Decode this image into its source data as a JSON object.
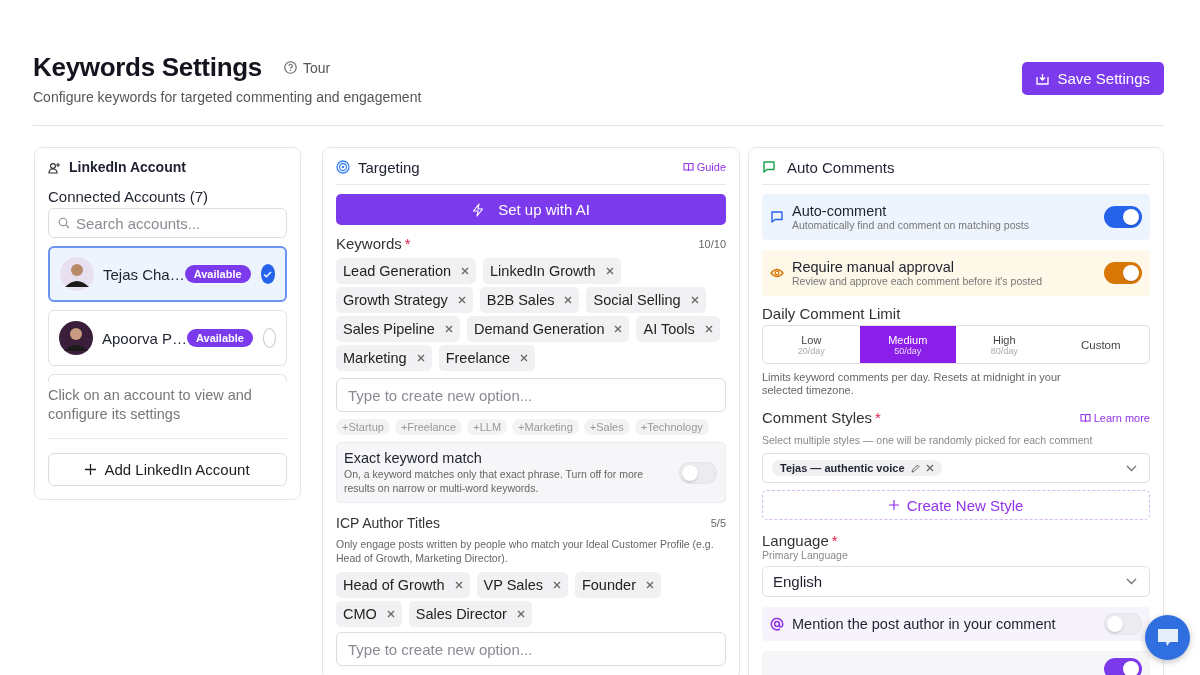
{
  "header": {
    "title": "Keywords Settings",
    "tour": "Tour",
    "subtitle": "Configure keywords for targeted commenting and engagement",
    "save_button": "Save Settings"
  },
  "accounts_panel": {
    "title": "LinkedIn Account",
    "connected_label": "Connected Accounts (7)",
    "search": {
      "placeholder": "Search accounts..."
    },
    "accounts": [
      {
        "name": "Tejas Cha…",
        "badge": "Available",
        "selected": true
      },
      {
        "name": "Apoorva P…",
        "badge": "Available",
        "selected": false
      }
    ],
    "hint": "Click on an account to view and configure its settings",
    "add_button": "Add LinkedIn Account"
  },
  "targeting": {
    "title": "Targeting",
    "guide": "Guide",
    "ai_button": "Set up with AI",
    "keywords": {
      "label": "Keywords",
      "required_mark": "*",
      "count": "10/10",
      "tags": [
        "Lead Generation",
        "LinkedIn Growth",
        "Growth Strategy",
        "B2B Sales",
        "Social Selling",
        "Sales Pipeline",
        "Demand Generation",
        "AI Tools",
        "Marketing",
        "Freelance"
      ],
      "input": {
        "placeholder": "Type to create new option..."
      },
      "suggestions": [
        "+Startup",
        "+Freelance",
        "+LLM",
        "+Marketing",
        "+Sales",
        "+Technology"
      ]
    },
    "exact_match": {
      "title": "Exact keyword match",
      "description": "On, a keyword matches only that exact phrase. Turn off for more results on narrow or multi-word keywords.",
      "on": false
    },
    "icp": {
      "label": "ICP Author Titles",
      "count": "5/5",
      "description": "Only engage posts written by people who match your Ideal Customer Profile (e.g. Head of Growth, Marketing Director).",
      "tags": [
        "Head of Growth",
        "VP Sales",
        "Founder",
        "CMO",
        "Sales Director"
      ],
      "input": {
        "placeholder": "Type to create new option..."
      }
    }
  },
  "auto_comments": {
    "title": "Auto Comments",
    "toggles": [
      {
        "kind": "comment",
        "title": "Auto-comment",
        "description": "Automatically find and comment on matching posts",
        "on": true,
        "color": "#2563eb"
      },
      {
        "kind": "eye",
        "title": "Require manual approval",
        "description": "Review and approve each comment before it's posted",
        "on": true,
        "color": "#d97706"
      }
    ],
    "daily_limit": {
      "label": "Daily Comment Limit",
      "options": [
        {
          "label": "Low",
          "sub": "20/day",
          "selected": false
        },
        {
          "label": "Medium",
          "sub": "50/day",
          "selected": true
        },
        {
          "label": "High",
          "sub": "80/day",
          "selected": false
        },
        {
          "label": "Custom",
          "selected": false
        }
      ],
      "note": "Limits keyword comments per day. Resets at midnight in your selected timezone."
    },
    "styles": {
      "label": "Comment Styles",
      "required_mark": "*",
      "learn_more": "Learn more",
      "description": "Select multiple styles — one will be randomly picked for each comment",
      "chips": [
        "Tejas — authentic voice"
      ],
      "create_button": "Create New Style"
    },
    "language": {
      "label": "Language",
      "required_mark": "*",
      "sublabel": "Primary Language",
      "value": "English"
    },
    "options": [
      {
        "kind": "mention",
        "label": "Mention the post author in your comment",
        "on": false
      },
      {
        "kind": "hidden",
        "on": true
      }
    ]
  }
}
